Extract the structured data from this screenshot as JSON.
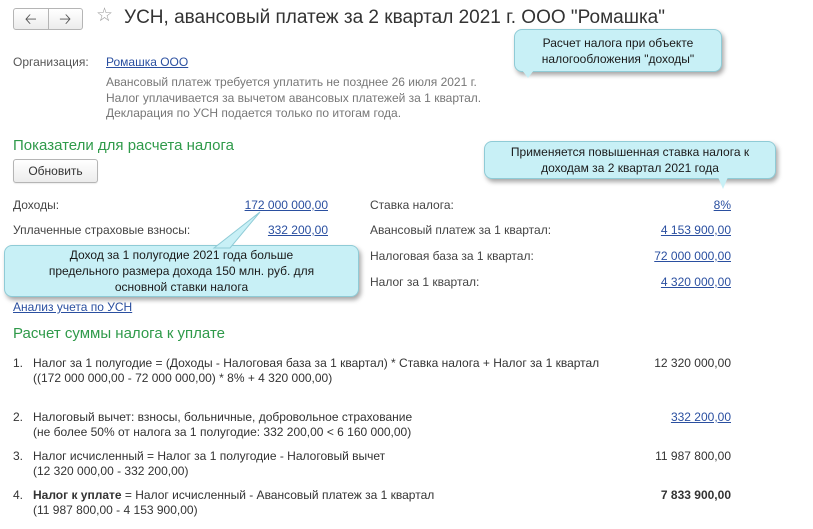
{
  "header": {
    "title": "УСН, авансовый платеж за 2 квартал 2021 г. ООО \"Ромашка\"",
    "back_icon": "arrow-left-icon",
    "forward_icon": "arrow-right-icon",
    "favorite_icon": "star-icon"
  },
  "org": {
    "label": "Организация:",
    "value": "Ромашка ООО",
    "notes": [
      "Авансовый платеж требуется уплатить не позднее 26 июля 2021 г.",
      "Налог уплачивается за вычетом авансовых платежей за 1 квартал.",
      "Декларация по УСН подается только по итогам года."
    ]
  },
  "indicators": {
    "title": "Показатели для расчета налога",
    "refresh_label": "Обновить",
    "left": [
      {
        "label": "Доходы:",
        "value": "172 000 000,00"
      },
      {
        "label": "Уплаченные страховые взносы:",
        "value": "332 200,00"
      }
    ],
    "right": [
      {
        "label": "Ставка налога:",
        "value": "8%"
      },
      {
        "label": "Авансовый платеж за 1 квартал:",
        "value": "4 153 900,00"
      },
      {
        "label": "Налоговая база за 1 квартал:",
        "value": "72 000 000,00"
      },
      {
        "label": "Налог за 1 квартал:",
        "value": "4 320 000,00"
      }
    ],
    "analysis_link": "Анализ учета по УСН"
  },
  "calculation": {
    "title": "Расчет суммы налога к уплате",
    "items": [
      {
        "num": "1.",
        "lines": [
          "Налог за 1 полугодие = (Доходы - Налоговая база за 1 квартал) * Ставка налога + Налог за 1 квартал",
          "((172 000 000,00 - 72 000 000,00) * 8% + 4 320 000,00)"
        ],
        "value": "12 320 000,00"
      },
      {
        "num": "2.",
        "lines": [
          "Налоговый вычет: взносы, больничные, добровольное страхование",
          "(не более 50% от налога за 1 полугодие: 332 200,00 < 6 160 000,00)"
        ],
        "value": "332 200,00"
      },
      {
        "num": "3.",
        "lines": [
          "Налог исчисленный = Налог за 1 полугодие - Налоговый вычет",
          "(12 320 000,00 - 332 200,00)"
        ],
        "value": "11 987 800,00"
      },
      {
        "num": "4.",
        "bold_prefix": "Налог к уплате",
        "lines": [
          " = Налог исчисленный - Авансовый платеж за 1 квартал",
          "(11 987 800,00 - 4 153 900,00)"
        ],
        "value": "7 833 900,00"
      }
    ]
  },
  "callouts": {
    "object": "Расчет налога при объекте налогообложения  \"доходы\"",
    "rate": "Применяется повышенная ставка налога к доходам за 2 квартал 2021 года",
    "income": "Доход за 1 полугодие 2021 года больше предельного размера дохода 150 млн. руб. для основной ставки налога"
  },
  "colors": {
    "accent_green": "#2f9a4a",
    "link_blue": "#2a4fa0",
    "callout_bg": "#c8f0f6"
  }
}
